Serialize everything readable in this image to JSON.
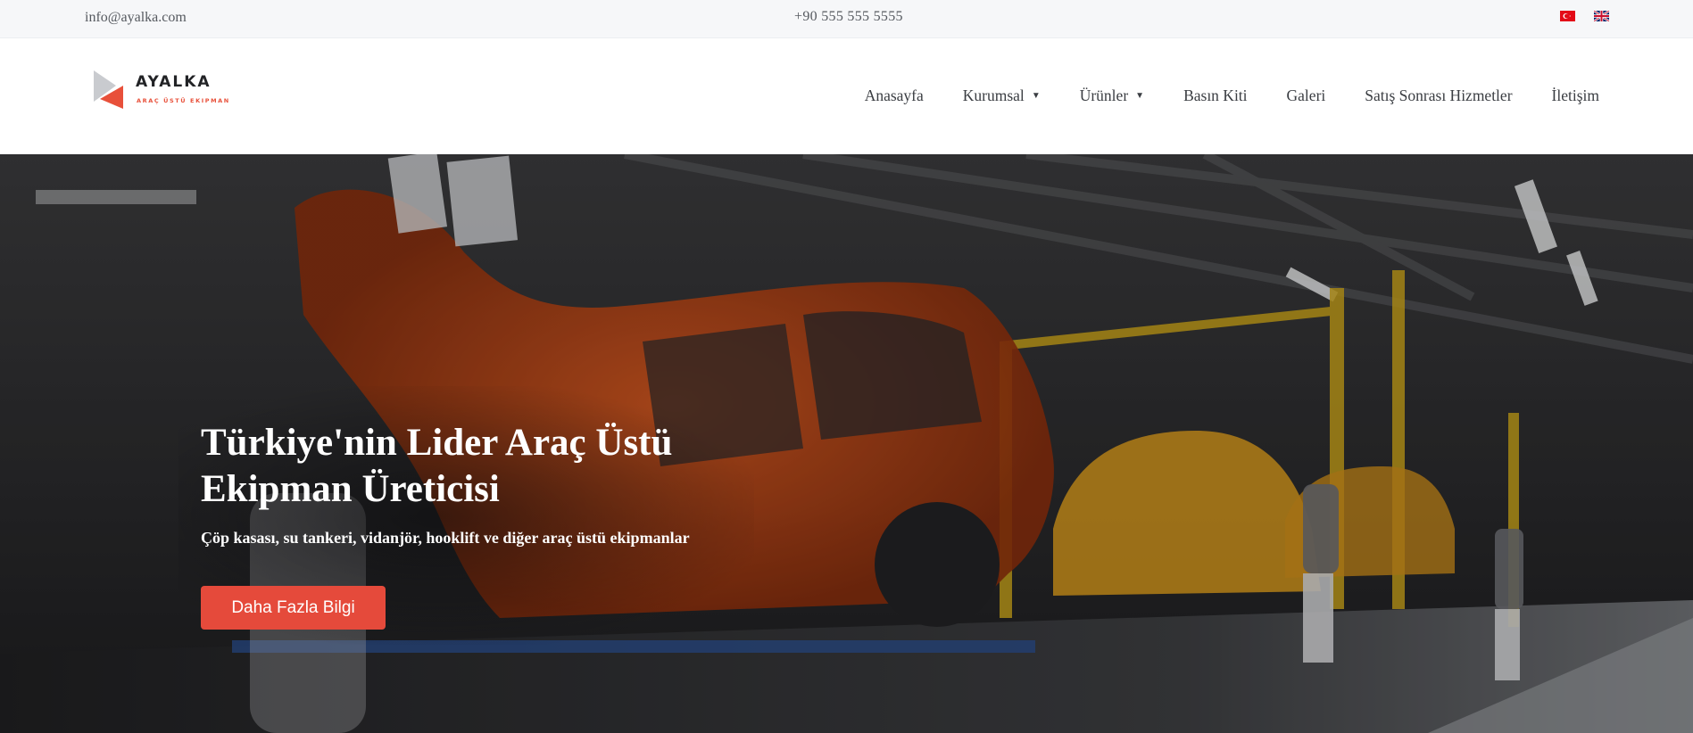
{
  "topbar": {
    "email": "info@ayalka.com",
    "phone": "+90 555 555 5555",
    "flags": [
      {
        "icon": "turkish-flag-icon"
      },
      {
        "icon": "uk-flag-icon"
      }
    ]
  },
  "logo": {
    "name": "AYALKA",
    "subtitle": "ARAÇ ÜSTÜ EKIPMAN"
  },
  "nav": {
    "items": [
      {
        "label": "Anasayfa",
        "has_dropdown": false
      },
      {
        "label": "Kurumsal",
        "has_dropdown": true
      },
      {
        "label": "Ürünler",
        "has_dropdown": true
      },
      {
        "label": "Basın Kiti",
        "has_dropdown": false
      },
      {
        "label": "Galeri",
        "has_dropdown": false
      },
      {
        "label": "Satış Sonrası Hizmetler",
        "has_dropdown": false
      },
      {
        "label": "İletişim",
        "has_dropdown": false
      }
    ],
    "caret": "▼"
  },
  "hero": {
    "title": "Türkiye'nin Lider Araç Üstü Ekipman Üreticisi",
    "subtitle": "Çöp kasası, su tankeri, vidanjör, hooklift ve diğer araç üstü ekipmanlar",
    "button_label": "Daha Fazla Bilgi",
    "image": "car-assembly-line-background"
  },
  "colors": {
    "accent": "#e54a3b",
    "topbar_bg": "#f6f7f9",
    "text": "#3a3d42"
  }
}
